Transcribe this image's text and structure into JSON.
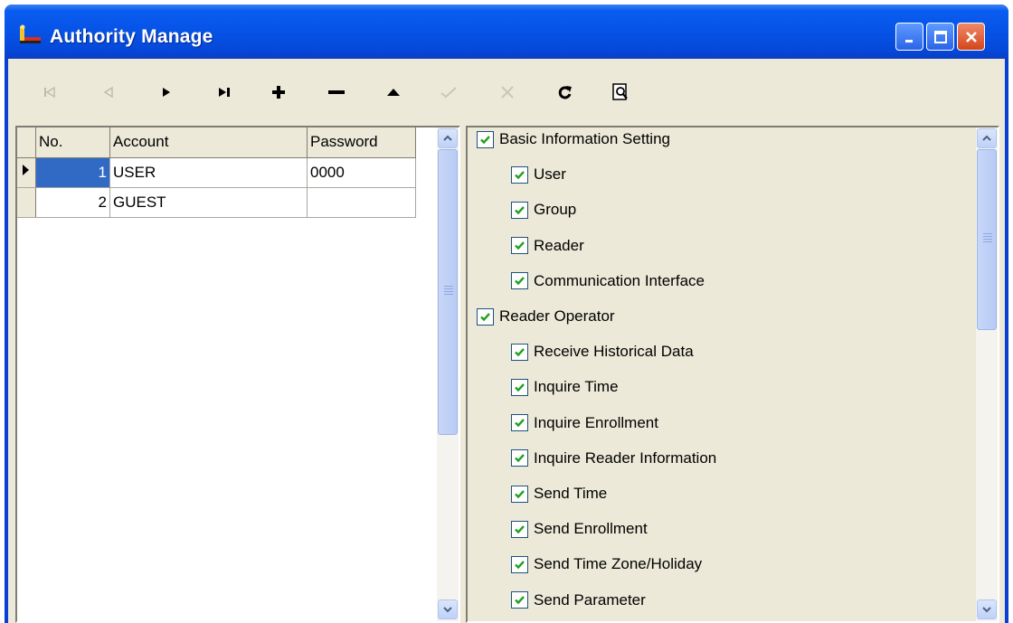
{
  "window": {
    "title": "Authority Manage",
    "controls": {
      "minimize_icon": "minimize-icon",
      "maximize_icon": "maximize-icon",
      "close_icon": "close-icon"
    }
  },
  "toolbar": {
    "buttons": [
      {
        "name": "first-record-button",
        "icon": "first-icon",
        "enabled": false
      },
      {
        "name": "prior-record-button",
        "icon": "prior-icon",
        "enabled": false
      },
      {
        "name": "next-record-button",
        "icon": "next-icon",
        "enabled": true
      },
      {
        "name": "last-record-button",
        "icon": "last-icon",
        "enabled": true
      },
      {
        "name": "insert-record-button",
        "icon": "plus-icon",
        "enabled": true
      },
      {
        "name": "delete-record-button",
        "icon": "minus-icon",
        "enabled": true
      },
      {
        "name": "edit-record-button",
        "icon": "up-icon",
        "enabled": true
      },
      {
        "name": "post-record-button",
        "icon": "check-icon",
        "enabled": false
      },
      {
        "name": "cancel-record-button",
        "icon": "cancel-icon",
        "enabled": false
      },
      {
        "name": "refresh-button",
        "icon": "refresh-icon",
        "enabled": true
      },
      {
        "name": "find-button",
        "icon": "find-icon",
        "enabled": true
      }
    ]
  },
  "grid": {
    "columns": [
      "No.",
      "Account",
      "Password"
    ],
    "rows": [
      {
        "no": "1",
        "account": "USER",
        "password": "0000",
        "selected": true
      },
      {
        "no": "2",
        "account": "GUEST",
        "password": "",
        "selected": false
      }
    ]
  },
  "permissions": [
    {
      "label": "Basic Information Setting",
      "checked": true,
      "level": 0
    },
    {
      "label": "User",
      "checked": true,
      "level": 1
    },
    {
      "label": "Group",
      "checked": true,
      "level": 1
    },
    {
      "label": "Reader",
      "checked": true,
      "level": 1
    },
    {
      "label": "Communication Interface",
      "checked": true,
      "level": 1
    },
    {
      "label": "Reader Operator",
      "checked": true,
      "level": 0
    },
    {
      "label": "Receive Historical Data",
      "checked": true,
      "level": 1
    },
    {
      "label": "Inquire Time",
      "checked": true,
      "level": 1
    },
    {
      "label": "Inquire Enrollment",
      "checked": true,
      "level": 1
    },
    {
      "label": "Inquire Reader Information",
      "checked": true,
      "level": 1
    },
    {
      "label": "Send Time",
      "checked": true,
      "level": 1
    },
    {
      "label": "Send Enrollment",
      "checked": true,
      "level": 1
    },
    {
      "label": "Send Time Zone/Holiday",
      "checked": true,
      "level": 1
    },
    {
      "label": "Send Parameter",
      "checked": true,
      "level": 1
    }
  ],
  "colors": {
    "title_bar": "#0653e6",
    "face": "#ece9d8",
    "selection": "#316ac5",
    "checkmark": "#21a121"
  }
}
